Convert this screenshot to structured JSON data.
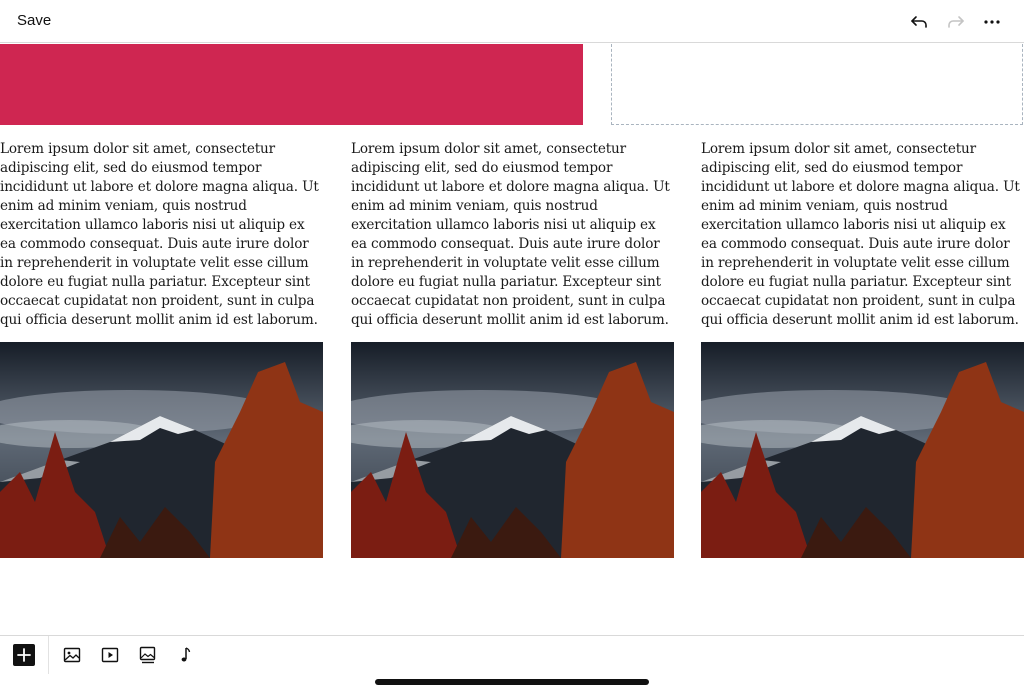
{
  "toolbar": {
    "save_label": "Save",
    "icons": [
      "undo-icon",
      "redo-icon",
      "more-icon"
    ]
  },
  "columns": [
    {
      "text": "Lorem ipsum dolor sit amet, consectetur adipiscing elit, sed do eiusmod tempor incididunt ut labore et dolore magna aliqua. Ut enim ad minim veniam, quis nostrud exercitation ullamco laboris nisi ut aliquip ex ea commodo consequat. Duis aute irure dolor in reprehenderit in voluptate velit esse cillum dolore eu fugiat nulla pariatur. Excepteur sint occaecat cupidatat non proident, sunt in culpa qui officia deserunt mollit anim id est laborum."
    },
    {
      "text": "Lorem ipsum dolor sit amet, consectetur adipiscing elit, sed do eiusmod tempor incididunt ut labore et dolore magna aliqua. Ut enim ad minim veniam, quis nostrud exercitation ullamco laboris nisi ut aliquip ex ea commodo consequat. Duis aute irure dolor in reprehenderit in voluptate velit esse cillum dolore eu fugiat nulla pariatur. Excepteur sint occaecat cupidatat non proident, sunt in culpa qui officia deserunt mollit anim id est laborum."
    },
    {
      "text": "Lorem ipsum dolor sit amet, consectetur adipiscing elit, sed do eiusmod tempor incididunt ut labore et dolore magna aliqua. Ut enim ad minim veniam, quis nostrud exercitation ullamco laboris nisi ut aliquip ex ea commodo consequat. Duis aute irure dolor in reprehenderit in voluptate velit esse cillum dolore eu fugiat nulla pariatur. Excepteur sint occaecat cupidatat non proident, sunt in culpa qui officia deserunt mollit anim id est laborum."
    }
  ],
  "bottom_toolbar": {
    "icons": [
      "add-icon",
      "image-icon",
      "video-icon",
      "gallery-icon",
      "audio-icon"
    ]
  },
  "colors": {
    "accent_block": "#cf2651",
    "dashed_border": "#a9b4bf"
  }
}
